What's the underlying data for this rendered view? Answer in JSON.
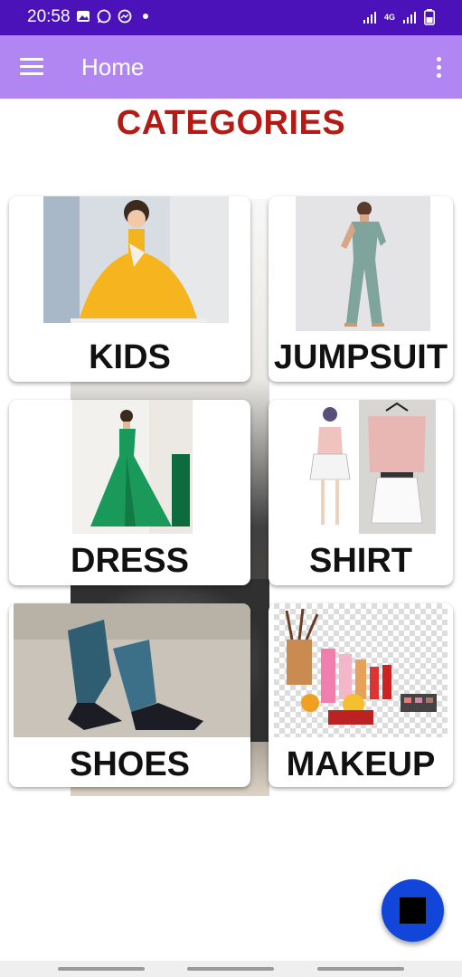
{
  "status_bar": {
    "time": "20:58",
    "network_type": "4G"
  },
  "app_bar": {
    "title": "Home"
  },
  "heading": "CATEGORIES",
  "categories": [
    {
      "label": "KIDS"
    },
    {
      "label": "JUMPSUIT"
    },
    {
      "label": "DRESS"
    },
    {
      "label": "SHIRT"
    },
    {
      "label": "SHOES"
    },
    {
      "label": "MAKEUP"
    }
  ],
  "colors": {
    "status_bar": "#4a12b8",
    "app_bar": "#b286f2",
    "heading": "#b31b14",
    "fab": "#1245d9"
  },
  "icons": {
    "menu": "hamburger-icon",
    "more": "more-vert-icon",
    "fab": "stop-square-icon"
  }
}
